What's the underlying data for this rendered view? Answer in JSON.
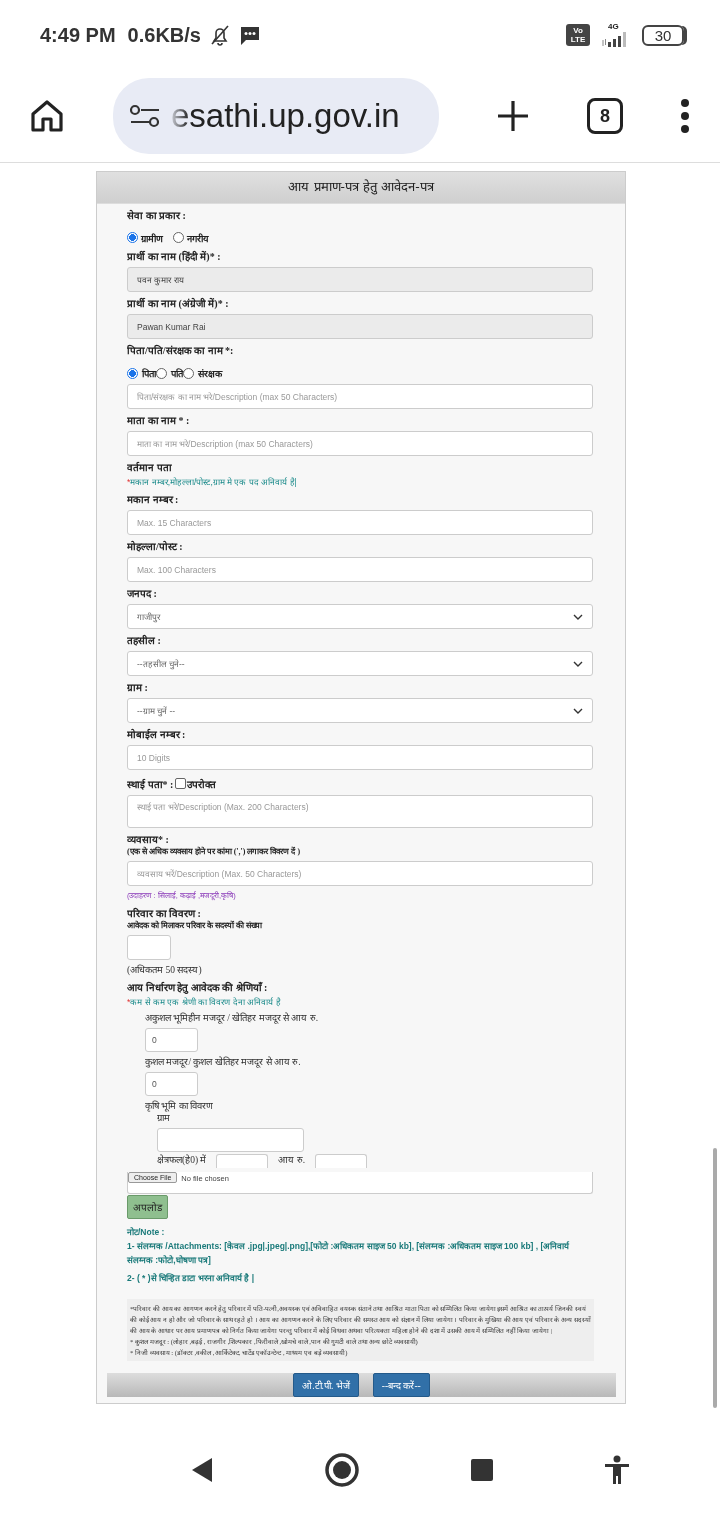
{
  "status_bar": {
    "time": "4:49 PM",
    "speed": "0.6KB/s",
    "volte": [
      "Vo",
      "LTE"
    ],
    "network": "4G",
    "battery": "30"
  },
  "browser": {
    "url": "esathi.up.gov.in",
    "tab_count": "8"
  },
  "form": {
    "title": "आय प्रमाण-पत्र हेतु आवेदन-पत्र",
    "items": [
      {
        "kind": "label",
        "text": "सेवा का प्रकार :"
      },
      {
        "kind": "radios",
        "options": [
          {
            "label": "ग्रामीण",
            "selected": true
          },
          {
            "label": "नगरीय",
            "selected": false
          }
        ]
      },
      {
        "kind": "label",
        "text": "प्रार्थी का नाम (हिंदी में)* :"
      },
      {
        "kind": "input",
        "value": "पवन कुमार राय",
        "disabled": true
      },
      {
        "kind": "label",
        "text": "प्रार्थी का नाम (अंग्रेजी में)* :"
      },
      {
        "kind": "input",
        "value": "Pawan Kumar Rai",
        "disabled": true
      },
      {
        "kind": "label",
        "text": "पिता/पति/संरक्षक का नाम *:"
      },
      {
        "kind": "radios",
        "options": [
          {
            "label": "पिता",
            "selected": true
          },
          {
            "label": "पति",
            "selected": false
          },
          {
            "label": "संरक्षक",
            "selected": false
          }
        ]
      },
      {
        "kind": "input",
        "placeholder": "पिता/संरक्षक का नाम भरे/Description (max 50 Characters)",
        "disabled": false
      },
      {
        "kind": "label",
        "text": "माता का नाम * :"
      },
      {
        "kind": "input",
        "placeholder": "माता का नाम भरे/Description (max 50 Characters)",
        "disabled": false
      },
      {
        "kind": "label",
        "text": "वर्तमान पता"
      },
      {
        "kind": "note",
        "mark": "*",
        "text": "मकान नम्बर,मोहल्ला/पोस्ट,ग्राम मे एक पद अनिवार्य है|"
      },
      {
        "kind": "label",
        "text": "मकान नम्बर :"
      },
      {
        "kind": "input",
        "placeholder": "Max. 15 Characters",
        "disabled": false
      },
      {
        "kind": "label",
        "text": "मोहल्ला/पोस्ट :"
      },
      {
        "kind": "input",
        "placeholder": "Max. 100 Characters",
        "disabled": false
      },
      {
        "kind": "label",
        "text": "जनपद :"
      },
      {
        "kind": "select",
        "value": "गाजीपुर"
      },
      {
        "kind": "label",
        "text": "तहसील :"
      },
      {
        "kind": "select",
        "value": "--तहसील चुने--"
      },
      {
        "kind": "label",
        "text": "ग्राम :"
      },
      {
        "kind": "select",
        "value": "--ग्राम चुनें --"
      },
      {
        "kind": "label",
        "text": "मोबाईल नम्बर :"
      },
      {
        "kind": "input",
        "placeholder": "10 Digits",
        "disabled": false
      },
      {
        "kind": "check_label",
        "text": "स्थाई पता* :",
        "option": "उपरोक्त",
        "checked": false
      },
      {
        "kind": "textarea",
        "placeholder": "स्थाई पता भरे/Description (Max. 200 Characters)"
      },
      {
        "kind": "label",
        "text": "व्यवसाय* :"
      },
      {
        "kind": "sublabel",
        "text": "(एक से अधिक व्यवसाय होने पर कांमा (',') लगाकर विवरण दें )"
      },
      {
        "kind": "input",
        "placeholder": "व्यवसाय भरें/Description (Max. 50 Characters)",
        "disabled": false
      },
      {
        "kind": "example",
        "text": "(उदाहरण : सिलाई, कढ़ाई ,मजदूरी,कृषि)"
      },
      {
        "kind": "label",
        "text": "परिवार का विवरण :"
      },
      {
        "kind": "sublabel",
        "text": "आवेदक को मिलाकर परिवार के सदस्यों की संख्या"
      },
      {
        "kind": "short_input",
        "disabled": false
      },
      {
        "kind": "text",
        "text": "(अधिकतम 50 सदस्य)"
      },
      {
        "kind": "label",
        "text": "आय निर्धारण हेतु आवेदक की श्रेणियाँ :"
      },
      {
        "kind": "note",
        "mark": "*",
        "text": "कम से कम एक श्रेणी का विवरण देना अनिवार्य है"
      },
      {
        "kind": "section",
        "children": [
          {
            "kind": "text",
            "text": "अकुशल भूमिहीन मजदूर / खेतिहर मजदूर से आय रु."
          },
          {
            "kind": "short_input",
            "value": "0",
            "disabled": false
          },
          {
            "kind": "text",
            "text": "कुशल मजदूर/ कुशल खेतिहर मजदूर से आय रु."
          },
          {
            "kind": "short_input",
            "value": "0",
            "disabled": false
          },
          {
            "kind": "text",
            "text": "कृषि भूमि का विवरण"
          },
          {
            "kind": "section",
            "children": [
              {
                "kind": "text",
                "text": "ग्राम"
              },
              {
                "kind": "short_input",
                "disabled": false
              },
              {
                "kind": "pair",
                "labels": [
                  "क्षेत्रफल(हे0) में",
                  "आय रु."
                ]
              }
            ]
          }
        ]
      }
    ]
  },
  "file": {
    "button": "Choose File",
    "status": "No file chosen"
  },
  "upload": "अपलोड",
  "notes": {
    "title": "नोट/Note :",
    "lines": [
      "1- संलग्नक /Attachments: [केवल .jpg|.jpeg|.png],[फोटो :अधिकतम साइज 50 kb], [संलग्नक :अधिकतम साइज 100 kb] , [अनिवार्य संलग्नक :फोटो,घोषणा पत्र]",
      "2- ( * )से चिन्हित डाटा भरना अनिवार्य है |"
    ]
  },
  "info": [
    "*परिवार की आय का आगणन करने हेतु परिवार में पति-पत्नी,अवयस्क एवं अविवाहित वयस्क संताने तथा आश्रित माता पिता को सम्मिलित किया जायेगा इसमें आश्रित का तात्पर्य जिनकी स्वयं की कोई आय न हो और जो परिवार के साथ रहते हो । आय का आगणन करने के लिए परिवार की समस्त आय को संज्ञान में लिया जायेगा । परिवार के मुखिया की आय एवं परिवार के अन्य सदस्यों की आय के आधार पर आय प्रमाणपत्र को निर्गत किया जायेगा परन्तु परिवार में कोई विधवा अथवा परित्यक्ता महिला होने की दशा में उसकी आय में सम्मिलित नहीं किया जायेगा |",
    "* कुशल मजदूर : (लोहार ,बढ़ई , राजगीर ,शिल्पकार ,फिरीवाले ,खोमचे वाले ,पान की गुमटी वाले तथा अन्य छोटे व्यवसायी)",
    "* निजी व्यवसाय : (डॉक्टर ,वकील ,आर्किटेक्ट, चार्टेड एकॉउन्टेन्ट , माध्यम एव बड़े व्यवसायी)"
  ],
  "actions": [
    "ओ.टी.पी. भेजें",
    "--बन्द करें--"
  ]
}
